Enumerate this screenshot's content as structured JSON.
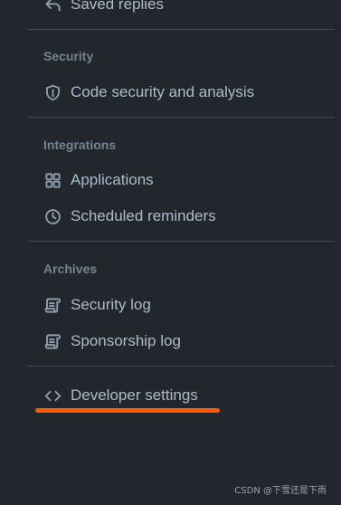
{
  "nav": {
    "top_item": {
      "label": "Saved replies",
      "icon": "reply-icon"
    },
    "sections": [
      {
        "heading": "Security",
        "items": [
          {
            "label": "Code security and analysis",
            "icon": "shield-icon"
          }
        ]
      },
      {
        "heading": "Integrations",
        "items": [
          {
            "label": "Applications",
            "icon": "apps-grid-icon"
          },
          {
            "label": "Scheduled reminders",
            "icon": "clock-icon"
          }
        ]
      },
      {
        "heading": "Archives",
        "items": [
          {
            "label": "Security log",
            "icon": "log-icon"
          },
          {
            "label": "Sponsorship log",
            "icon": "log-icon"
          }
        ]
      }
    ],
    "bottom_item": {
      "label": "Developer settings",
      "icon": "code-icon"
    }
  },
  "annotation": {
    "underline_color": "#ff5a00"
  },
  "watermark": "CSDN @下雪还是下雨"
}
